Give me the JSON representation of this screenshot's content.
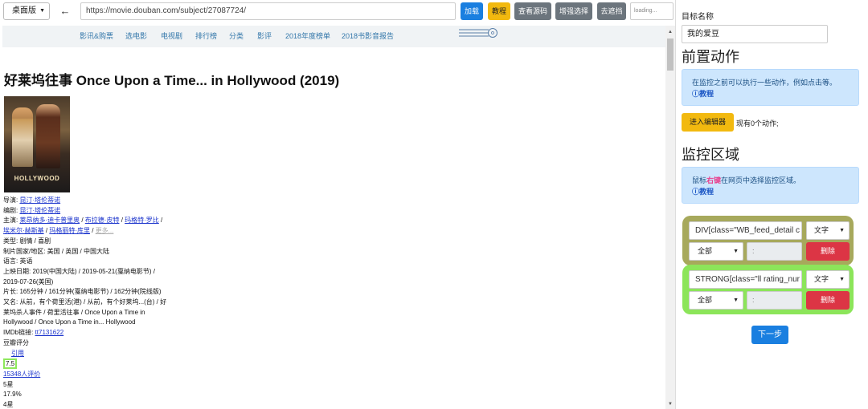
{
  "toolbar": {
    "mode": "桌面版",
    "url": "https://movie.douban.com/subject/27087724/",
    "load": "加载",
    "tutorial": "教程",
    "view_source": "查看源码",
    "enhanced_select": "增强选择",
    "remove_cover": "去遮挡",
    "loading_placeholder": "loading..."
  },
  "nav": {
    "items": [
      "影讯&购票",
      "选电影",
      "电视剧",
      "排行榜",
      "分类",
      "影评",
      "2018年度榜单",
      "2018书影音报告"
    ]
  },
  "movie": {
    "title": "好莱坞往事 Once Upon a Time... in Hollywood (2019)",
    "poster_text": "HOLLYWOOD",
    "director_label": "导演: ",
    "director": "昆汀·塔伦蒂诺",
    "writer_label": "编剧: ",
    "writer": "昆汀·塔伦蒂诺",
    "cast_label": "主演: ",
    "cast": [
      "莱昂纳多·迪卡普里奥",
      "布拉德·皮特",
      "玛格特·罗比",
      "埃米尔·赫斯基",
      "玛格丽特·库里"
    ],
    "more": "更多...",
    "genre": "类型: 剧情 / 喜剧",
    "region": "制片国家/地区: 美国 / 英国 / 中国大陆",
    "language": "语言: 英语",
    "release_1": "上映日期: 2019(中国大陆) / 2019-05-21(戛纳电影节) /",
    "release_2": "2019-07-26(美国)",
    "runtime_1": "片长: 165分钟 / 161分钟(戛纳电影节) / 162分钟(院线版)",
    "aka_1": "又名: 从前，有个荷里活(港) / 从前，有个好莱坞...(台) / 好",
    "aka_2": "莱坞杀人事件 / 荷里活往事 / Once Upon a Time in",
    "aka_3": "Hollywood / Once Upon a Time in... Hollywood",
    "imdb_label": "IMDb链接: ",
    "imdb": "tt7131622",
    "rating_label": "豆瓣评分",
    "quote": "引用",
    "rating": "7.5",
    "votes": "15348人评价",
    "star5": "5星",
    "star5_pct": "17.9%",
    "star4": "4星"
  },
  "panel": {
    "target_label": "目标名称",
    "target_value": "我的爱豆",
    "pre_action_title": "前置动作",
    "pre_action_hint": "在监控之前可以执行一些动作，例如点击等。",
    "tutorial_link": "ⓘ教程",
    "editor_button": "进入编辑器",
    "action_count": "现有0个动作;",
    "monitor_title": "监控区域",
    "monitor_hint_pre": "鼠标",
    "monitor_hint_kw": "右键",
    "monitor_hint_post": "在网页中选择监控区域。",
    "selectors": [
      {
        "selector": "DIV[class=\"WB_feed_detail c",
        "type": "文字",
        "scope": "全部",
        "range": ":",
        "delete": "删除",
        "color": "#a7a95c"
      },
      {
        "selector": "STRONG[class=\"ll rating_nur",
        "type": "文字",
        "scope": "全部",
        "range": ":",
        "delete": "删除",
        "color": "#8ce55a"
      }
    ],
    "next": "下一步"
  }
}
